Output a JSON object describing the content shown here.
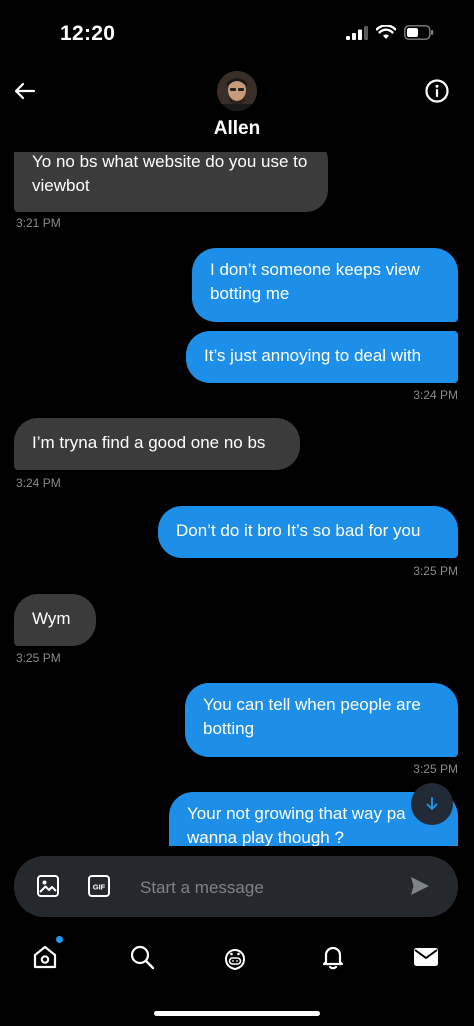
{
  "status_bar": {
    "time": "12:20"
  },
  "header": {
    "contact_name": "Allen",
    "back_icon": "arrow-left-icon",
    "info_icon": "info-circle-icon"
  },
  "messages": [
    {
      "direction": "in",
      "text": "Yo no bs what website do you use to viewbot"
    },
    {
      "direction": "in",
      "timestamp": "3:21 PM"
    },
    {
      "direction": "out",
      "text": "I don’t someone keeps view botting me"
    },
    {
      "direction": "out",
      "text": "It’s just annoying to deal with"
    },
    {
      "direction": "out",
      "timestamp": "3:24 PM"
    },
    {
      "direction": "in",
      "text": "I’m tryna find a good one no bs"
    },
    {
      "direction": "in",
      "timestamp": "3:24 PM"
    },
    {
      "direction": "out",
      "text": "Don’t do it bro It’s so bad for you"
    },
    {
      "direction": "out",
      "timestamp": "3:25 PM"
    },
    {
      "direction": "in",
      "text": "Wym"
    },
    {
      "direction": "in",
      "timestamp": "3:25 PM"
    },
    {
      "direction": "out",
      "text": "You can tell when people are botting"
    },
    {
      "direction": "out",
      "timestamp": "3:25 PM"
    },
    {
      "direction": "out",
      "text": "Your not growing that way pa wanna play though ?"
    }
  ],
  "composer": {
    "placeholder": "Start a message",
    "gif_label": "GIF"
  },
  "tabbar": {
    "items": [
      "home-icon",
      "search-icon",
      "spaces-icon",
      "notifications-icon",
      "messages-icon"
    ]
  },
  "colors": {
    "outgoing_bubble": "#1d8fe8",
    "incoming_bubble": "#3b3b3b",
    "timestamp": "#8b8b8b",
    "accent": "#1d9bf0"
  }
}
